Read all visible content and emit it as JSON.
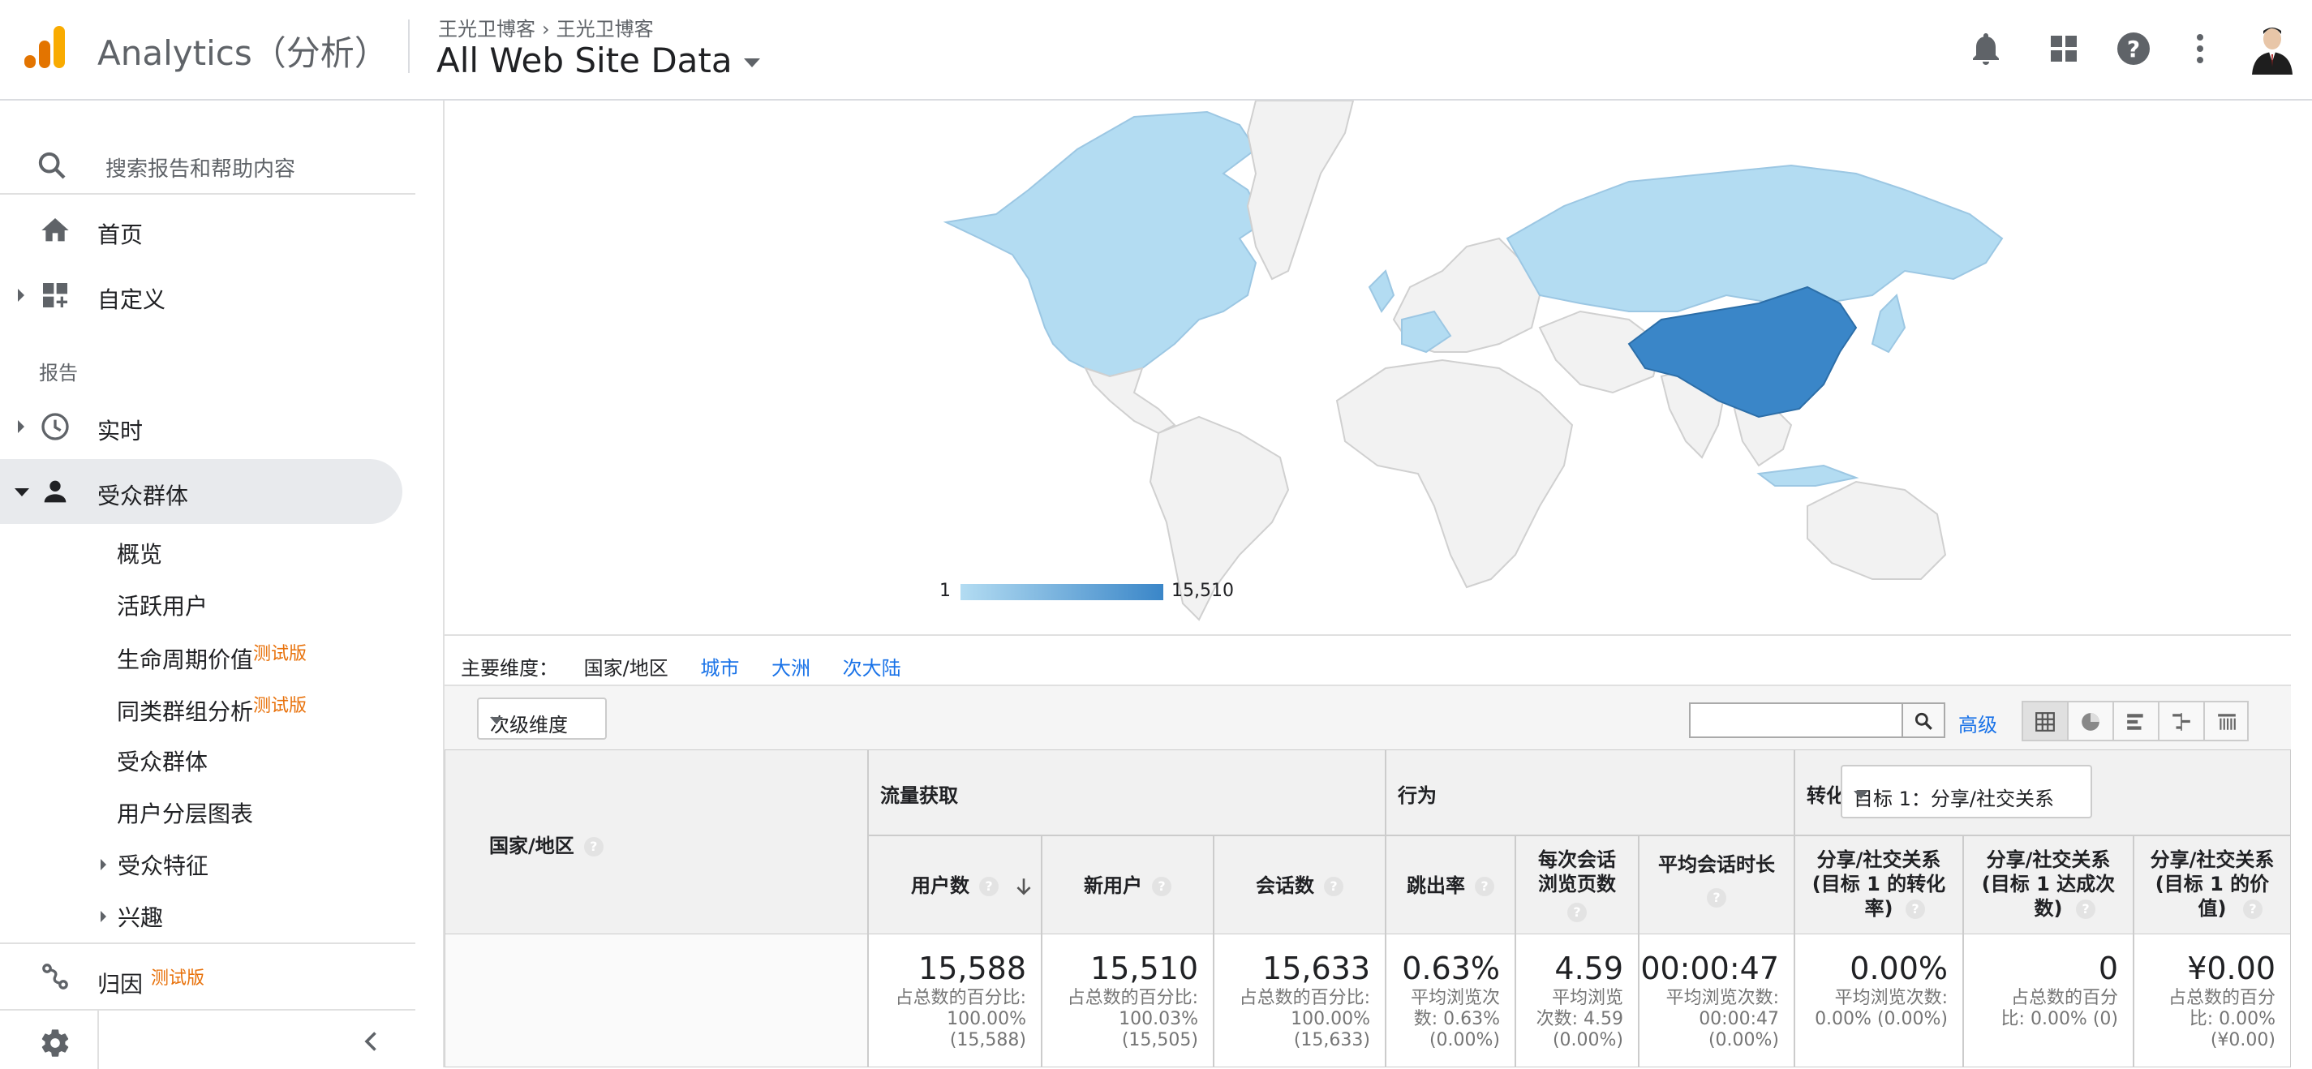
{
  "header": {
    "app_title": "Analytics（分析）",
    "breadcrumb_account": "王光卫博客",
    "breadcrumb_property": "王光卫博客",
    "view_name": "All Web Site Data",
    "icons": [
      "bell-icon",
      "apps-grid-icon",
      "help-icon",
      "more-vert-icon",
      "user-avatar"
    ]
  },
  "sidebar": {
    "search_placeholder": "搜索报告和帮助内容",
    "home": "首页",
    "customization": "自定义",
    "reports_heading": "报告",
    "realtime": "实时",
    "audience": "受众群体",
    "audience_sub": {
      "overview": "概览",
      "active_users": "活跃用户",
      "lifetime_value": "生命周期价值",
      "cohort": "同类群组分析",
      "audiences": "受众群体",
      "user_explorer": "用户分层图表",
      "demographics": "受众特征",
      "interests": "兴趣"
    },
    "beta_label": "测试版",
    "attribution": "归因"
  },
  "map": {
    "legend_min": "1",
    "legend_max": "15,510",
    "color_low": "#b3dcf2",
    "color_high": "#3a86c8"
  },
  "dimension": {
    "label": "主要维度：",
    "selected": "国家/地区",
    "links": [
      "城市",
      "大洲",
      "次大陆"
    ]
  },
  "toolbar": {
    "secondary_dimension": "次级维度",
    "search_value": "",
    "advanced": "高级"
  },
  "table": {
    "col_country": "国家/地区",
    "group_acquisition": "流量获取",
    "group_behavior": "行为",
    "group_conversion": "转化",
    "goal_select": "目标 1：分享/社交关系",
    "columns": [
      {
        "label": "用户数",
        "value": "15,588",
        "sub": "占总数的百分比:\n100.00%\n(15,588)"
      },
      {
        "label": "新用户",
        "value": "15,510",
        "sub": "占总数的百分比:\n100.03%\n(15,505)"
      },
      {
        "label": "会话数",
        "value": "15,633",
        "sub": "占总数的百分比:\n100.00%\n(15,633)"
      },
      {
        "label": "跳出率",
        "value": "0.63%",
        "sub": "平均浏览次\n数: 0.63%\n(0.00%)"
      },
      {
        "label": "每次会话\n浏览页数",
        "value": "4.59",
        "sub": "平均浏览\n次数: 4.59\n(0.00%)"
      },
      {
        "label": "平均会话时长",
        "value": "00:00:47",
        "sub": "平均浏览次数:\n00:00:47\n(0.00%)"
      },
      {
        "label": "分享/社交关系\n(目标 1 的转化\n率)",
        "value": "0.00%",
        "sub": "平均浏览次数:\n0.00% (0.00%)"
      },
      {
        "label": "分享/社交关系\n(目标 1 达成次\n数)",
        "value": "0",
        "sub": "占总数的百分\n比: 0.00% (0)"
      },
      {
        "label": "分享/社交关系\n(目标 1 的价\n值)",
        "value": "¥0.00",
        "sub": "占总数的百分\n比: 0.00%\n(¥0.00)"
      }
    ]
  }
}
